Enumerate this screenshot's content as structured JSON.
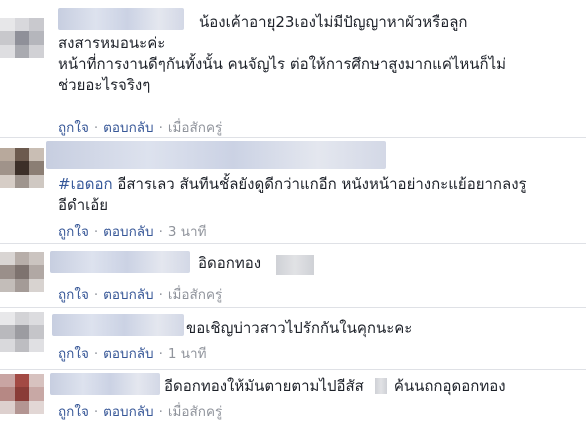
{
  "comments": [
    {
      "lines": [
        "น้องเค้าอายุ23เองไม่มีปัญญาหาผัวหรือลูก",
        "สงสารหมอนะค่ะ",
        "หน้าที่การงานดีๆกันทั้งนั้น คนจัญไร ต่อให้การศึกษาสูงมากแค่ไหนก็ไม่",
        "ช่วยอะไรจริงๆ"
      ],
      "like": "ถูกใจ",
      "reply": "ตอบกลับ",
      "time": "เมื่อสักครู่"
    },
    {
      "tag": "#เอดอก",
      "line1_rest": " อีสารเลว สันทีนชั้ลยังดูดีกว่าแกอีก หนังหน้าอย่างกะแย้อยากลงรู",
      "line2": "อีดำเอ้ย",
      "like": "ถูกใจ",
      "reply": "ตอบกลับ",
      "time": "3 นาที"
    },
    {
      "text": "อิดอกทอง",
      "like": "ถูกใจ",
      "reply": "ตอบกลับ",
      "time": "เมื่อสักครู่"
    },
    {
      "text": "ขอเชิญบ่าวสาวไปรักกันในคุกนะคะ",
      "like": "ถูกใจ",
      "reply": "ตอบกลับ",
      "time": "1 นาที"
    },
    {
      "text_a": "อีดอกทองให้มันตายตามไปอีสัส",
      "text_b": "ค้นนถกอุดอกทอง",
      "like": "ถูกใจ",
      "reply": "ตอบกลับ",
      "time": "เมื่อสักครู่"
    }
  ],
  "dot": "·",
  "colors": {
    "link": "#385898",
    "tag": "#365899",
    "meta": "#90949c",
    "separator": "#dfe1e6"
  }
}
